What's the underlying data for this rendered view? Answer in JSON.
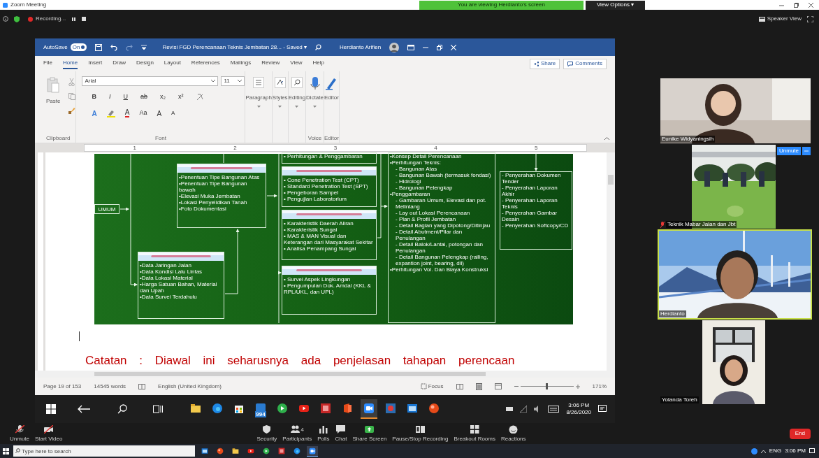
{
  "zoom_window": {
    "title": "Zoom Meeting",
    "share_banner": "You are viewing Herdianto's screen",
    "view_options": "View Options ▾",
    "recording": "Recording...",
    "view_mode": "Speaker View"
  },
  "word": {
    "autosave": {
      "label": "AutoSave",
      "on": true,
      "state": "On"
    },
    "title": "Revisi FGD Perencanaan Teknis Jembatan 28... - Saved ▾",
    "user": "Herdianto Arifien",
    "tabs": [
      {
        "label": "File",
        "selected": false
      },
      {
        "label": "Home",
        "selected": true
      },
      {
        "label": "Insert",
        "selected": false
      },
      {
        "label": "Draw",
        "selected": false
      },
      {
        "label": "Design",
        "selected": false
      },
      {
        "label": "Layout",
        "selected": false
      },
      {
        "label": "References",
        "selected": false
      },
      {
        "label": "Mailings",
        "selected": false
      },
      {
        "label": "Review",
        "selected": false
      },
      {
        "label": "View",
        "selected": false
      },
      {
        "label": "Help",
        "selected": false
      }
    ],
    "share": "Share",
    "comments": "Comments",
    "ribbon": {
      "paste": "Paste",
      "clipboard_group": "Clipboard",
      "font": "Arial",
      "size": "11",
      "format_row": [
        "B",
        "I",
        "U",
        "ab",
        "x₂",
        "x²"
      ],
      "color_row": [
        "A",
        "A",
        "Aa",
        "A",
        "A"
      ],
      "font_group": "Font",
      "big_buttons": [
        {
          "label": "Paragraph",
          "kind": "paragraph"
        },
        {
          "label": "Styles",
          "kind": "styles"
        },
        {
          "label": "Editing",
          "kind": "editing"
        },
        {
          "label": "Dictate",
          "kind": "dictate",
          "group": "Voice"
        },
        {
          "label": "Editor",
          "kind": "editor",
          "group": "Editor"
        }
      ]
    },
    "ruler_marks": [
      "1",
      "2",
      "3",
      "4",
      "5"
    ],
    "document": {
      "flowchart": {
        "boxes": [
          {
            "kind": "label",
            "items": [
              {
                "text": "UMUM"
              }
            ]
          },
          {
            "kind": "list",
            "header": true,
            "items": [
              {
                "text": "•Penentuan Tipe Bangunan Atas"
              },
              {
                "text": "•Penentuan Tipe Bangunan bawah"
              },
              {
                "text": "•Elevasi Muka Jembatan"
              },
              {
                "text": "•Lokasi Penyelidikan Tanah"
              },
              {
                "text": "•Foto Dokumentasi"
              }
            ]
          },
          {
            "kind": "list",
            "header": true,
            "items": [
              {
                "text": "•Data Jaringan Jalan"
              },
              {
                "text": "•Data Kondisi Lalu Lintas"
              },
              {
                "text": "•Data Lokasi Material"
              },
              {
                "text": "•Harga Satuan Bahan, Material dan Upah"
              },
              {
                "text": "•Data Survei Terdahulu"
              }
            ]
          },
          {
            "kind": "list",
            "header": false,
            "items": [
              {
                "text": "• Perhitungan & Penggambaran"
              }
            ]
          },
          {
            "kind": "list",
            "header": true,
            "items": [
              {
                "text": "• Cone Penetration Test (CPT)"
              },
              {
                "text": "• Standard Penetration Test (SPT)"
              },
              {
                "text": "• Pengeboran Sampel"
              },
              {
                "text": "• Pengujian Laboratorium"
              }
            ]
          },
          {
            "kind": "list",
            "header": true,
            "items": [
              {
                "text": "• Karakteristik Daerah Aliran"
              },
              {
                "text": "• Karakteristik Sungai"
              },
              {
                "text": "• MAS & MAN Visual dan Keterangan dari Masyarakat Sekitar"
              },
              {
                "text": "• Analisa Penampang Sungai"
              }
            ]
          },
          {
            "kind": "list",
            "header": true,
            "items": [
              {
                "text": "• Survei Aspek Lingkungan"
              },
              {
                "text": "• Pengumpulan Dok. Amdal (KKL & RPL/UKL, dan UPL)"
              }
            ]
          },
          {
            "kind": "list",
            "header": false,
            "items": [
              {
                "text": "•Konsep Detail Perencanaan"
              },
              {
                "text": "•Perhitungan Teknis:",
                "children": [
                  {
                    "text": "- Bangunan Atas"
                  },
                  {
                    "text": "- Bangunan Bawah (termasuk fondasi)"
                  },
                  {
                    "text": "- Hidrologi"
                  },
                  {
                    "text": "- Bangunan Pelengkap"
                  }
                ]
              },
              {
                "text": "•Penggambaran",
                "children": [
                  {
                    "text": "- Gambaran Umum, Elevasi dan pot. Melintang"
                  },
                  {
                    "text": "- Lay out Lokasi Perencanaan"
                  },
                  {
                    "text": "- Plan & Profil Jembatan"
                  },
                  {
                    "text": "- Detail Bagian yang Dipotong/Ditinjau"
                  },
                  {
                    "text": "- Detail Abutment/Pilar dan Penulangan"
                  },
                  {
                    "text": "- Detail Balok/Lantai, potongan dan Penulangan"
                  },
                  {
                    "text": "- Detail Bangunan Pelengkap (railing, expantion joint, bearing, dll)"
                  }
                ]
              },
              {
                "text": "•Perhitungan Vol. Dan Biaya Konstruksi"
              }
            ]
          },
          {
            "kind": "list",
            "header": false,
            "items": [
              {
                "text": "- Penyerahan Dokumen Tender"
              },
              {
                "text": "- Penyerahan Laporan Akhir"
              },
              {
                "text": "- Penyerahan Laporan Teknis"
              },
              {
                "text": "- Penyerahan Gambar Desain"
              },
              {
                "text": "- Penyerahan Softcopy/CD"
              }
            ]
          }
        ]
      },
      "note": "Catatan : Diawal ini seharusnya ada penjelasan tahapan perencaan"
    },
    "status_bar": {
      "page": "Page 19 of 153",
      "words": "14545 words",
      "language": "English (United Kingdom)",
      "focus": "Focus",
      "zoom": {
        "level": 0.5
      },
      "zoom_label": "171%"
    },
    "taskbar": {
      "apps": [
        {
          "kind": "folder",
          "active": false
        },
        {
          "kind": "edge",
          "active": false
        },
        {
          "kind": "store",
          "active": false
        },
        {
          "kind": "badge",
          "label": "994",
          "active": false
        },
        {
          "kind": "green",
          "active": false
        },
        {
          "kind": "play",
          "active": false
        },
        {
          "kind": "square",
          "active": false
        },
        {
          "kind": "office",
          "active": false
        },
        {
          "kind": "zoom",
          "active": true
        },
        {
          "kind": "photos",
          "active": false
        },
        {
          "kind": "window",
          "active": false
        },
        {
          "kind": "sphere",
          "active": false
        }
      ],
      "time": "3:06 PM",
      "date": "8/26/2020"
    }
  },
  "participants": [
    {
      "name": "Eunike Widyaningsih",
      "kind": "person",
      "speaking": false,
      "muted": false
    },
    {
      "name": "Teknik Mabar Jalan dan Jbt",
      "kind": "scene",
      "speaking": false,
      "muted": true,
      "unmute_button": "Unmute"
    },
    {
      "name": "Herdianto",
      "kind": "bridge",
      "speaking": true,
      "muted": false
    },
    {
      "name": "Yolanda Toreh",
      "kind": "window",
      "speaking": false,
      "muted": false
    }
  ],
  "toolbar": [
    {
      "label": "Unmute",
      "kind": "mic"
    },
    {
      "label": "Start Video",
      "kind": "video"
    },
    {
      "label": "Security",
      "kind": "shield"
    },
    {
      "label": "Participants",
      "kind": "people",
      "count": "4"
    },
    {
      "label": "Polls",
      "kind": "polls"
    },
    {
      "label": "Chat",
      "kind": "chat"
    },
    {
      "label": "Share Screen",
      "kind": "share"
    },
    {
      "label": "Pause/Stop Recording",
      "kind": "record"
    },
    {
      "label": "Breakout Rooms",
      "kind": "rooms"
    },
    {
      "label": "Reactions",
      "kind": "smile"
    }
  ],
  "end_button": "End",
  "os_taskbar": {
    "search_placeholder": "Type here to search",
    "apps": [
      {
        "kind": "window",
        "active": false
      },
      {
        "kind": "sphere",
        "active": false
      },
      {
        "kind": "folder",
        "active": false
      },
      {
        "kind": "play",
        "active": false
      },
      {
        "kind": "green",
        "active": false
      },
      {
        "kind": "square",
        "active": false
      },
      {
        "kind": "edge",
        "active": false
      },
      {
        "kind": "zoom",
        "active": true
      }
    ],
    "language": "ENG",
    "time": "3:06 PM"
  }
}
